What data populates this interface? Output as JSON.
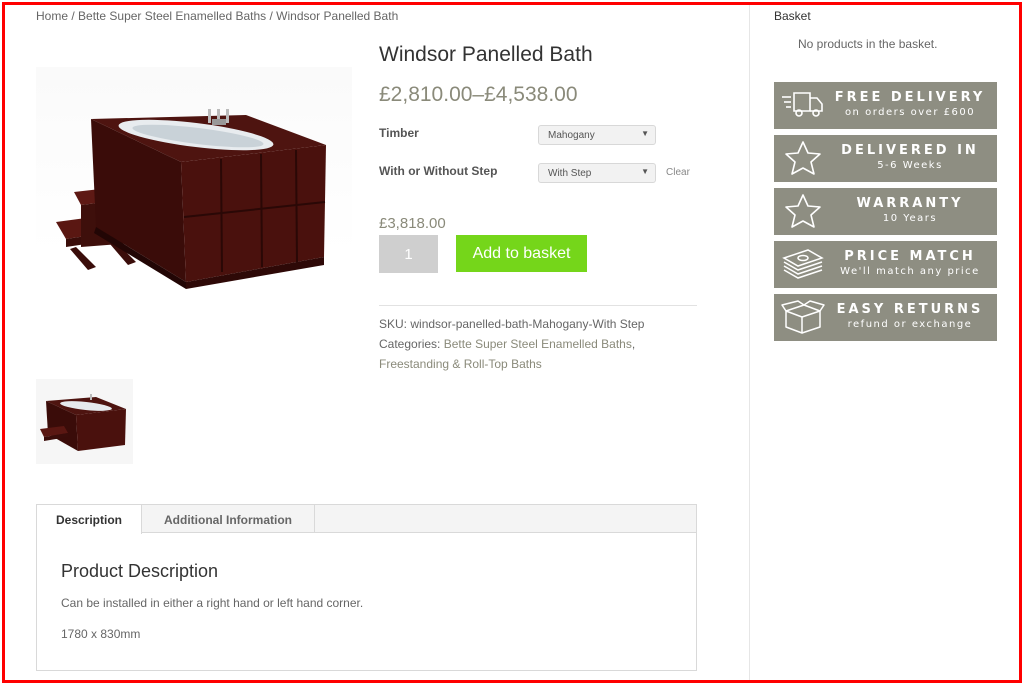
{
  "breadcrumb": {
    "home": "Home",
    "sep1": " / ",
    "category": "Bette Super Steel Enamelled Baths",
    "sep2": " / ",
    "current": "Windsor Panelled Bath"
  },
  "product": {
    "title": "Windsor Panelled Bath",
    "price_range": "£2,810.00–£4,538.00",
    "variations": [
      {
        "label": "Timber",
        "selected": "Mahogany"
      },
      {
        "label": "With or Without Step",
        "selected": "With Step"
      }
    ],
    "clear_label": "Clear",
    "variation_price": "£3,818.00",
    "quantity": "1",
    "add_to_basket_label": "Add to basket",
    "sku_label": "SKU:",
    "sku_value": "windsor-panelled-bath-Mahogany-With Step",
    "categories_label": "Categories:",
    "categories": [
      "Bette Super Steel Enamelled Baths",
      "Freestanding & Roll-Top Baths"
    ],
    "categories_sep": ", "
  },
  "tabs": {
    "items": [
      {
        "label": "Description",
        "active": true
      },
      {
        "label": "Additional Information",
        "active": false
      }
    ],
    "heading": "Product Description",
    "paragraphs": [
      "Can be installed in either a right hand or left hand corner.",
      "1780 x 830mm"
    ]
  },
  "sidebar": {
    "basket_title": "Basket",
    "basket_empty": "No products in the basket.",
    "banners": [
      {
        "icon": "delivery-truck-icon",
        "main": "FREE DELIVERY",
        "sub": "on orders over £600"
      },
      {
        "icon": "star-icon",
        "main": "DELIVERED IN",
        "sub": "5-6 Weeks"
      },
      {
        "icon": "star-icon",
        "main": "WARRANTY",
        "sub": "10 Years"
      },
      {
        "icon": "money-stack-icon",
        "main": "PRICE MATCH",
        "sub": "We'll match any price"
      },
      {
        "icon": "box-icon",
        "main": "EASY RETURNS",
        "sub": "refund or exchange"
      }
    ]
  },
  "colors": {
    "accent_green": "#75d61a",
    "banner_grey": "#8e8e82",
    "frame_red": "#ff0000",
    "bath_wood": "#4e1410"
  }
}
